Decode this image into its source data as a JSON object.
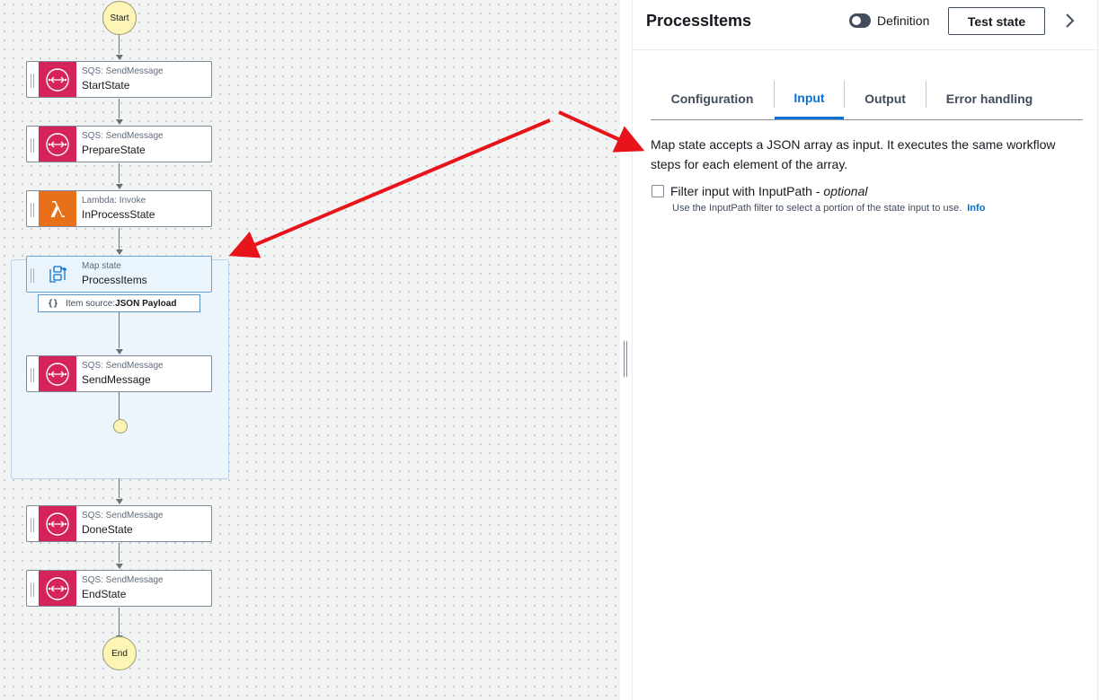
{
  "workflow": {
    "start_label": "Start",
    "end_label": "End",
    "states": [
      {
        "type": "SQS: SendMessage",
        "name": "StartState",
        "icon": "sqs-icon",
        "color": "#d6245a"
      },
      {
        "type": "SQS: SendMessage",
        "name": "PrepareState",
        "icon": "sqs-icon",
        "color": "#d6245a"
      },
      {
        "type": "Lambda: Invoke",
        "name": "InProcessState",
        "icon": "lambda-icon",
        "color": "#e8701a"
      },
      {
        "type": "Map state",
        "name": "ProcessItems",
        "icon": "map-state-icon",
        "selected": true
      },
      {
        "type": "SQS: SendMessage",
        "name": "SendMessage",
        "icon": "sqs-icon",
        "color": "#d6245a"
      },
      {
        "type": "SQS: SendMessage",
        "name": "DoneState",
        "icon": "sqs-icon",
        "color": "#d6245a"
      },
      {
        "type": "SQS: SendMessage",
        "name": "EndState",
        "icon": "sqs-icon",
        "color": "#d6245a"
      }
    ],
    "item_source": {
      "prefix": "Item source: ",
      "value": "JSON Payload"
    }
  },
  "panel": {
    "title": "ProcessItems",
    "toggle_label": "Definition",
    "toggle_on": false,
    "test_button": "Test state",
    "tabs": [
      {
        "label": "Configuration",
        "active": false
      },
      {
        "label": "Input",
        "active": true
      },
      {
        "label": "Output",
        "active": false
      },
      {
        "label": "Error handling",
        "active": false
      }
    ],
    "description": "Map state accepts a JSON array as input. It executes the same workflow steps for each element of the array.",
    "filter": {
      "label": "Filter input with InputPath - ",
      "optional": "optional",
      "checked": false,
      "help": "Use the InputPath filter to select a portion of the state input to use.",
      "info_link": "Info"
    }
  },
  "colors": {
    "accent": "#0972d3",
    "annotation_arrow": "#e8141b",
    "map_bg": "#eaf4fc"
  }
}
